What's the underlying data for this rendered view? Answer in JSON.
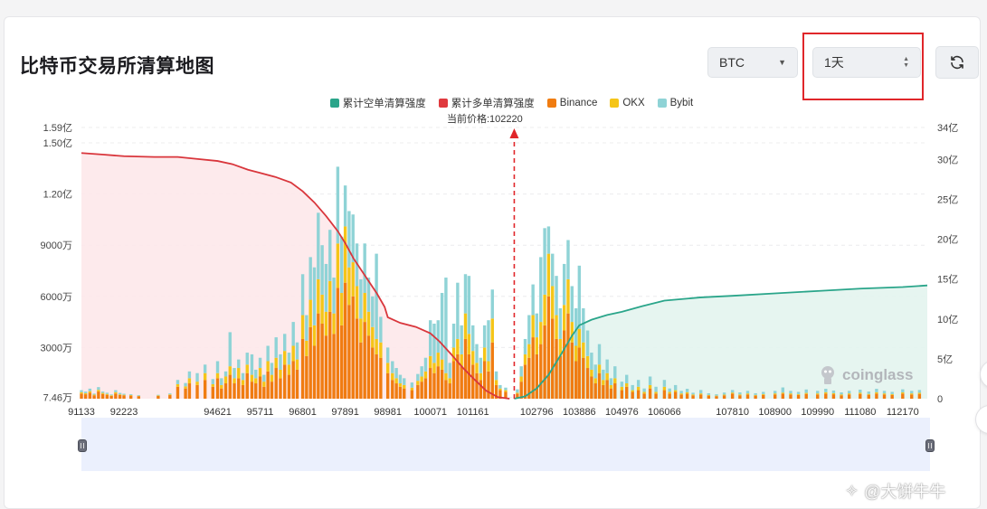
{
  "header": {
    "title": "比特币交易所清算地图",
    "coin_select": "BTC",
    "range_select": "1天"
  },
  "legend": {
    "items": [
      {
        "label": "累计空单清算强度",
        "color": "#2aa58a"
      },
      {
        "label": "累计多单清算强度",
        "color": "#e0393e"
      },
      {
        "label": "Binance",
        "color": "#f07c11"
      },
      {
        "label": "OKX",
        "color": "#f5c518"
      },
      {
        "label": "Bybit",
        "color": "#8fd3d6"
      }
    ]
  },
  "current_price": "当前价格:102220",
  "watermark": "coinglass",
  "credit": "@大饼牛牛",
  "chart_data": {
    "type": "bar",
    "x_range": [
      91133,
      112800
    ],
    "current_price": 102220,
    "left_axis_ticks": [
      "7.46万",
      "3000万",
      "6000万",
      "9000万",
      "1.20亿",
      "1.50亿",
      "1.59亿"
    ],
    "left_axis_values": [
      746000,
      30000000,
      60000000,
      90000000,
      120000000,
      150000000,
      159000000
    ],
    "right_axis_ticks": [
      "0",
      "5亿",
      "10亿",
      "15亿",
      "20亿",
      "25亿",
      "30亿",
      "34亿"
    ],
    "right_axis_values": [
      0,
      5,
      10,
      15,
      20,
      25,
      30,
      34
    ],
    "x_ticks": [
      "91133",
      "92223",
      "94621",
      "95711",
      "96801",
      "97891",
      "98981",
      "100071",
      "101161",
      "102796",
      "103886",
      "104976",
      "106066",
      "107810",
      "108900",
      "109990",
      "111080",
      "112170"
    ],
    "x_tick_values": [
      91133,
      92223,
      94621,
      95711,
      96801,
      97891,
      98981,
      100071,
      101161,
      102796,
      103886,
      104976,
      106066,
      107810,
      108900,
      109990,
      111080,
      112170
    ],
    "series": [
      {
        "name": "累计多单清算强度",
        "axis": "right",
        "points": [
          [
            91133,
            30.8
          ],
          [
            91700,
            30.6
          ],
          [
            92223,
            30.4
          ],
          [
            93000,
            30.3
          ],
          [
            93600,
            30.3
          ],
          [
            94000,
            30.1
          ],
          [
            94621,
            29.8
          ],
          [
            95000,
            29.4
          ],
          [
            95400,
            28.7
          ],
          [
            95711,
            28.3
          ],
          [
            96100,
            27.8
          ],
          [
            96500,
            27.1
          ],
          [
            96801,
            26.0
          ],
          [
            97100,
            24.6
          ],
          [
            97400,
            22.9
          ],
          [
            97700,
            21.0
          ],
          [
            97891,
            19.5
          ],
          [
            98100,
            17.6
          ],
          [
            98400,
            15.4
          ],
          [
            98700,
            13.2
          ],
          [
            98900,
            11.5
          ],
          [
            98981,
            10.2
          ],
          [
            99300,
            9.5
          ],
          [
            99700,
            9.0
          ],
          [
            100071,
            8.2
          ],
          [
            100300,
            7.2
          ],
          [
            100600,
            5.6
          ],
          [
            100900,
            3.9
          ],
          [
            101161,
            2.6
          ],
          [
            101500,
            1.0
          ],
          [
            101800,
            0.2
          ],
          [
            102100,
            0.0
          ]
        ]
      },
      {
        "name": "累计空单清算强度",
        "axis": "right",
        "points": [
          [
            102220,
            0.0
          ],
          [
            102500,
            0.3
          ],
          [
            102796,
            1.3
          ],
          [
            103100,
            3.0
          ],
          [
            103400,
            5.4
          ],
          [
            103700,
            7.9
          ],
          [
            103886,
            9.2
          ],
          [
            104200,
            9.9
          ],
          [
            104600,
            10.5
          ],
          [
            104976,
            10.9
          ],
          [
            105500,
            11.6
          ],
          [
            106066,
            12.3
          ],
          [
            107000,
            12.7
          ],
          [
            107810,
            12.9
          ],
          [
            108900,
            13.2
          ],
          [
            109990,
            13.5
          ],
          [
            111080,
            13.8
          ],
          [
            112170,
            14.0
          ],
          [
            112800,
            14.2
          ]
        ]
      }
    ],
    "bars_note": "stacked bars per price level (Binance/OKX/Bybit) in left-axis units (万)",
    "bars": [
      [
        91133,
        300,
        80,
        120
      ],
      [
        91240,
        260,
        60,
        100
      ],
      [
        91350,
        350,
        90,
        150
      ],
      [
        91460,
        200,
        40,
        60
      ],
      [
        91570,
        420,
        100,
        160
      ],
      [
        91680,
        280,
        60,
        80
      ],
      [
        91790,
        230,
        50,
        70
      ],
      [
        91900,
        160,
        40,
        50
      ],
      [
        92010,
        300,
        80,
        120
      ],
      [
        92120,
        220,
        40,
        80
      ],
      [
        92223,
        200,
        30,
        60
      ],
      [
        92400,
        180,
        30,
        50
      ],
      [
        92600,
        150,
        20,
        40
      ],
      [
        93100,
        160,
        30,
        40
      ],
      [
        93400,
        210,
        40,
        60
      ],
      [
        93600,
        700,
        150,
        250
      ],
      [
        93800,
        600,
        120,
        200
      ],
      [
        93900,
        900,
        300,
        400
      ],
      [
        94100,
        800,
        200,
        500
      ],
      [
        94300,
        1100,
        400,
        500
      ],
      [
        94500,
        700,
        150,
        300
      ],
      [
        94621,
        1200,
        300,
        700
      ],
      [
        94720,
        600,
        200,
        400
      ],
      [
        94830,
        900,
        400,
        300
      ],
      [
        94940,
        1400,
        500,
        2000
      ],
      [
        95050,
        900,
        300,
        600
      ],
      [
        95160,
        1200,
        600,
        500
      ],
      [
        95270,
        800,
        300,
        400
      ],
      [
        95380,
        1500,
        500,
        700
      ],
      [
        95500,
        1000,
        400,
        1200
      ],
      [
        95600,
        900,
        300,
        500
      ],
      [
        95711,
        1300,
        500,
        600
      ],
      [
        95810,
        700,
        300,
        400
      ],
      [
        95910,
        1600,
        600,
        900
      ],
      [
        96010,
        1000,
        400,
        700
      ],
      [
        96120,
        1800,
        600,
        1200
      ],
      [
        96230,
        1200,
        500,
        900
      ],
      [
        96340,
        2000,
        800,
        1000
      ],
      [
        96450,
        1400,
        600,
        700
      ],
      [
        96560,
        2200,
        900,
        1400
      ],
      [
        96660,
        1700,
        600,
        1000
      ],
      [
        96801,
        3500,
        1400,
        2400
      ],
      [
        96900,
        2500,
        900,
        1500
      ],
      [
        97000,
        4200,
        1600,
        2500
      ],
      [
        97100,
        3100,
        1200,
        3400
      ],
      [
        97200,
        5000,
        2000,
        3900
      ],
      [
        97300,
        4400,
        1700,
        2900
      ],
      [
        97400,
        3700,
        1400,
        2800
      ],
      [
        97500,
        5100,
        1800,
        3000
      ],
      [
        97600,
        3800,
        1200,
        2100
      ],
      [
        97700,
        6500,
        2600,
        4500
      ],
      [
        97800,
        4300,
        1900,
        3300
      ],
      [
        97891,
        6800,
        3300,
        2400
      ],
      [
        97990,
        5500,
        2200,
        3300
      ],
      [
        98090,
        6000,
        2000,
        2800
      ],
      [
        98190,
        4700,
        1900,
        2500
      ],
      [
        98290,
        3300,
        1400,
        2300
      ],
      [
        98390,
        4500,
        1700,
        2900
      ],
      [
        98490,
        3700,
        1400,
        2000
      ],
      [
        98590,
        3000,
        1200,
        1800
      ],
      [
        98690,
        2600,
        900,
        5000
      ],
      [
        98800,
        2400,
        900,
        1500
      ],
      [
        98981,
        1500,
        600,
        900
      ],
      [
        99100,
        1100,
        400,
        700
      ],
      [
        99200,
        900,
        300,
        600
      ],
      [
        99300,
        700,
        200,
        500
      ],
      [
        99400,
        600,
        200,
        400
      ],
      [
        99600,
        500,
        150,
        300
      ],
      [
        99750,
        800,
        250,
        400
      ],
      [
        99850,
        1000,
        300,
        600
      ],
      [
        99950,
        1200,
        400,
        800
      ],
      [
        100071,
        1800,
        700,
        2100
      ],
      [
        100170,
        1500,
        600,
        2300
      ],
      [
        100270,
        1900,
        800,
        1900
      ],
      [
        100370,
        1700,
        600,
        3900
      ],
      [
        100470,
        1100,
        400,
        5600
      ],
      [
        100570,
        900,
        300,
        900
      ],
      [
        100670,
        2200,
        800,
        1400
      ],
      [
        100770,
        2600,
        900,
        3300
      ],
      [
        100870,
        1900,
        700,
        1700
      ],
      [
        100970,
        3500,
        1500,
        2300
      ],
      [
        101060,
        2600,
        1200,
        3400
      ],
      [
        101161,
        2000,
        800,
        1500
      ],
      [
        101260,
        1500,
        600,
        1100
      ],
      [
        101360,
        1100,
        400,
        900
      ],
      [
        101460,
        2200,
        800,
        1300
      ],
      [
        101560,
        1600,
        600,
        2400
      ],
      [
        101660,
        3300,
        1400,
        1700
      ],
      [
        101760,
        800,
        300,
        500
      ],
      [
        101860,
        500,
        100,
        200
      ],
      [
        102000,
        400,
        100,
        150
      ],
      [
        102300,
        300,
        50,
        200
      ],
      [
        102400,
        1000,
        300,
        600
      ],
      [
        102500,
        2000,
        600,
        900
      ],
      [
        102600,
        2400,
        800,
        1700
      ],
      [
        102700,
        3600,
        1300,
        1800
      ],
      [
        102796,
        2600,
        1000,
        1400
      ],
      [
        102900,
        3200,
        1300,
        3800
      ],
      [
        103000,
        4300,
        1800,
        3900
      ],
      [
        103100,
        6000,
        2500,
        1600
      ],
      [
        103200,
        4700,
        1900,
        1900
      ],
      [
        103300,
        3500,
        1400,
        2300
      ],
      [
        103400,
        2500,
        1000,
        1800
      ],
      [
        103500,
        4000,
        1500,
        2400
      ],
      [
        103600,
        5000,
        2000,
        2300
      ],
      [
        103700,
        3300,
        1200,
        2100
      ],
      [
        103800,
        2200,
        900,
        2200
      ],
      [
        103886,
        3000,
        1100,
        3700
      ],
      [
        103990,
        2400,
        900,
        2000
      ],
      [
        104100,
        1800,
        700,
        1500
      ],
      [
        104200,
        1300,
        400,
        1000
      ],
      [
        104300,
        900,
        300,
        800
      ],
      [
        104400,
        1500,
        500,
        1200
      ],
      [
        104500,
        800,
        300,
        600
      ],
      [
        104600,
        1100,
        400,
        800
      ],
      [
        104700,
        600,
        200,
        400
      ],
      [
        104800,
        900,
        300,
        700
      ],
      [
        104976,
        500,
        200,
        300
      ],
      [
        105100,
        700,
        200,
        500
      ],
      [
        105250,
        400,
        100,
        300
      ],
      [
        105400,
        500,
        200,
        400
      ],
      [
        105550,
        300,
        100,
        200
      ],
      [
        105700,
        600,
        200,
        500
      ],
      [
        105850,
        300,
        100,
        300
      ],
      [
        106066,
        500,
        200,
        400
      ],
      [
        106200,
        300,
        100,
        200
      ],
      [
        106350,
        400,
        100,
        300
      ],
      [
        106500,
        250,
        60,
        150
      ],
      [
        106650,
        300,
        80,
        200
      ],
      [
        106800,
        200,
        50,
        100
      ],
      [
        107000,
        250,
        60,
        200
      ],
      [
        107200,
        180,
        40,
        100
      ],
      [
        107400,
        150,
        30,
        80
      ],
      [
        107600,
        200,
        40,
        120
      ],
      [
        107810,
        300,
        60,
        150
      ],
      [
        108000,
        200,
        50,
        120
      ],
      [
        108200,
        250,
        60,
        150
      ],
      [
        108400,
        180,
        40,
        100
      ],
      [
        108600,
        220,
        50,
        130
      ],
      [
        108900,
        250,
        60,
        150
      ],
      [
        109100,
        300,
        60,
        300
      ],
      [
        109300,
        250,
        60,
        150
      ],
      [
        109500,
        220,
        50,
        130
      ],
      [
        109700,
        280,
        60,
        200
      ],
      [
        109990,
        250,
        60,
        150
      ],
      [
        110200,
        300,
        80,
        200
      ],
      [
        110400,
        260,
        60,
        160
      ],
      [
        110600,
        200,
        50,
        120
      ],
      [
        110800,
        250,
        60,
        150
      ],
      [
        111080,
        280,
        70,
        180
      ],
      [
        111300,
        230,
        50,
        140
      ],
      [
        111500,
        300,
        80,
        200
      ],
      [
        111700,
        250,
        60,
        150
      ],
      [
        111900,
        220,
        50,
        130
      ],
      [
        112170,
        300,
        70,
        180
      ],
      [
        112400,
        250,
        60,
        150
      ],
      [
        112600,
        280,
        70,
        160
      ]
    ]
  }
}
